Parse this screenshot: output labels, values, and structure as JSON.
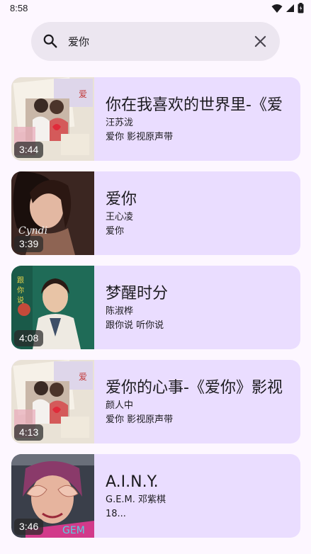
{
  "status_bar": {
    "time": "8:58",
    "icons": [
      "wifi-icon",
      "signal-icon",
      "battery-icon"
    ]
  },
  "search": {
    "query": "爱你",
    "icon": "search-icon",
    "clear_icon": "close-icon"
  },
  "results": [
    {
      "title": "你在我喜欢的世界里-《爱",
      "artist": "汪苏泷",
      "album": "爱你 影视原声带",
      "duration": "3:44"
    },
    {
      "title": "爱你",
      "artist": "王心凌",
      "album": "爱你",
      "duration": "3:39"
    },
    {
      "title": "梦醒时分",
      "artist": "陈淑桦",
      "album": "跟你说 听你说",
      "duration": "4:08"
    },
    {
      "title": "爱你的心事-《爱你》影视",
      "artist": "颜人中",
      "album": "爱你 影视原声带",
      "duration": "4:13"
    },
    {
      "title": "A.I.N.Y.",
      "artist": "G.E.M. 邓紫棋",
      "album": "18...",
      "duration": "3:46"
    }
  ],
  "colors": {
    "background": "#fdf7ff",
    "card": "#eaddff",
    "search_bar": "#ece6f0"
  }
}
